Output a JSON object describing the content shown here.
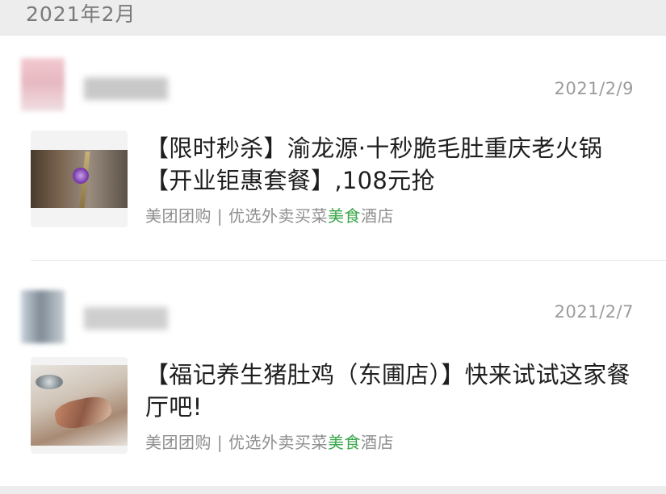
{
  "header": {
    "month": "2021年2月"
  },
  "feed": [
    {
      "date": "2021/2/9",
      "title": "【限时秒杀】渝龙源·十秒脆毛肚重庆老火锅【开业钜惠套餐】,108元抢",
      "tags": {
        "platform": "美团团购",
        "separator": "|",
        "prefix": "优选外卖买菜",
        "highlight": "美食",
        "suffix": "酒店"
      }
    },
    {
      "date": "2021/2/7",
      "title": "【福记养生猪肚鸡（东圃店）】快来试试这家餐厅吧!",
      "tags": {
        "platform": "美团团购",
        "separator": "|",
        "prefix": "优选外卖买菜",
        "highlight": "美食",
        "suffix": "酒店"
      }
    }
  ],
  "colors": {
    "highlight": "#3aa64a",
    "header_bg": "#ededed"
  }
}
